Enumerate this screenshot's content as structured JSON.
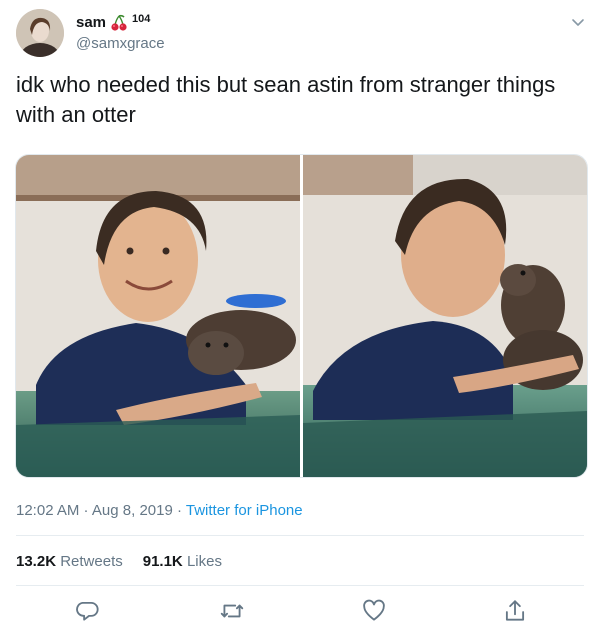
{
  "author": {
    "display_name": "sam",
    "badge_emoji": "cherries",
    "badge_number": "104",
    "handle": "@samxgrace",
    "avatar_icon": "profile-photo"
  },
  "tweet": {
    "text": "idk who needed this but sean astin from stranger things\nwith an otter"
  },
  "media": {
    "count": 2,
    "photos": [
      {
        "description_icon": "photo-1"
      },
      {
        "description_icon": "photo-2"
      }
    ]
  },
  "meta": {
    "time": "12:02 AM",
    "separator": " · ",
    "date": "Aug 8, 2019",
    "source": "Twitter for iPhone"
  },
  "stats": {
    "retweets_count": "13.2K",
    "retweets_label": "Retweets",
    "likes_count": "91.1K",
    "likes_label": "Likes"
  },
  "actions": {
    "icons": [
      "reply-icon",
      "retweet-icon",
      "like-icon",
      "share-icon"
    ]
  },
  "colors": {
    "text": "#14171a",
    "secondary": "#657786",
    "link": "#1b95e0",
    "icon": "#657786",
    "divider": "#e6ecf0"
  }
}
